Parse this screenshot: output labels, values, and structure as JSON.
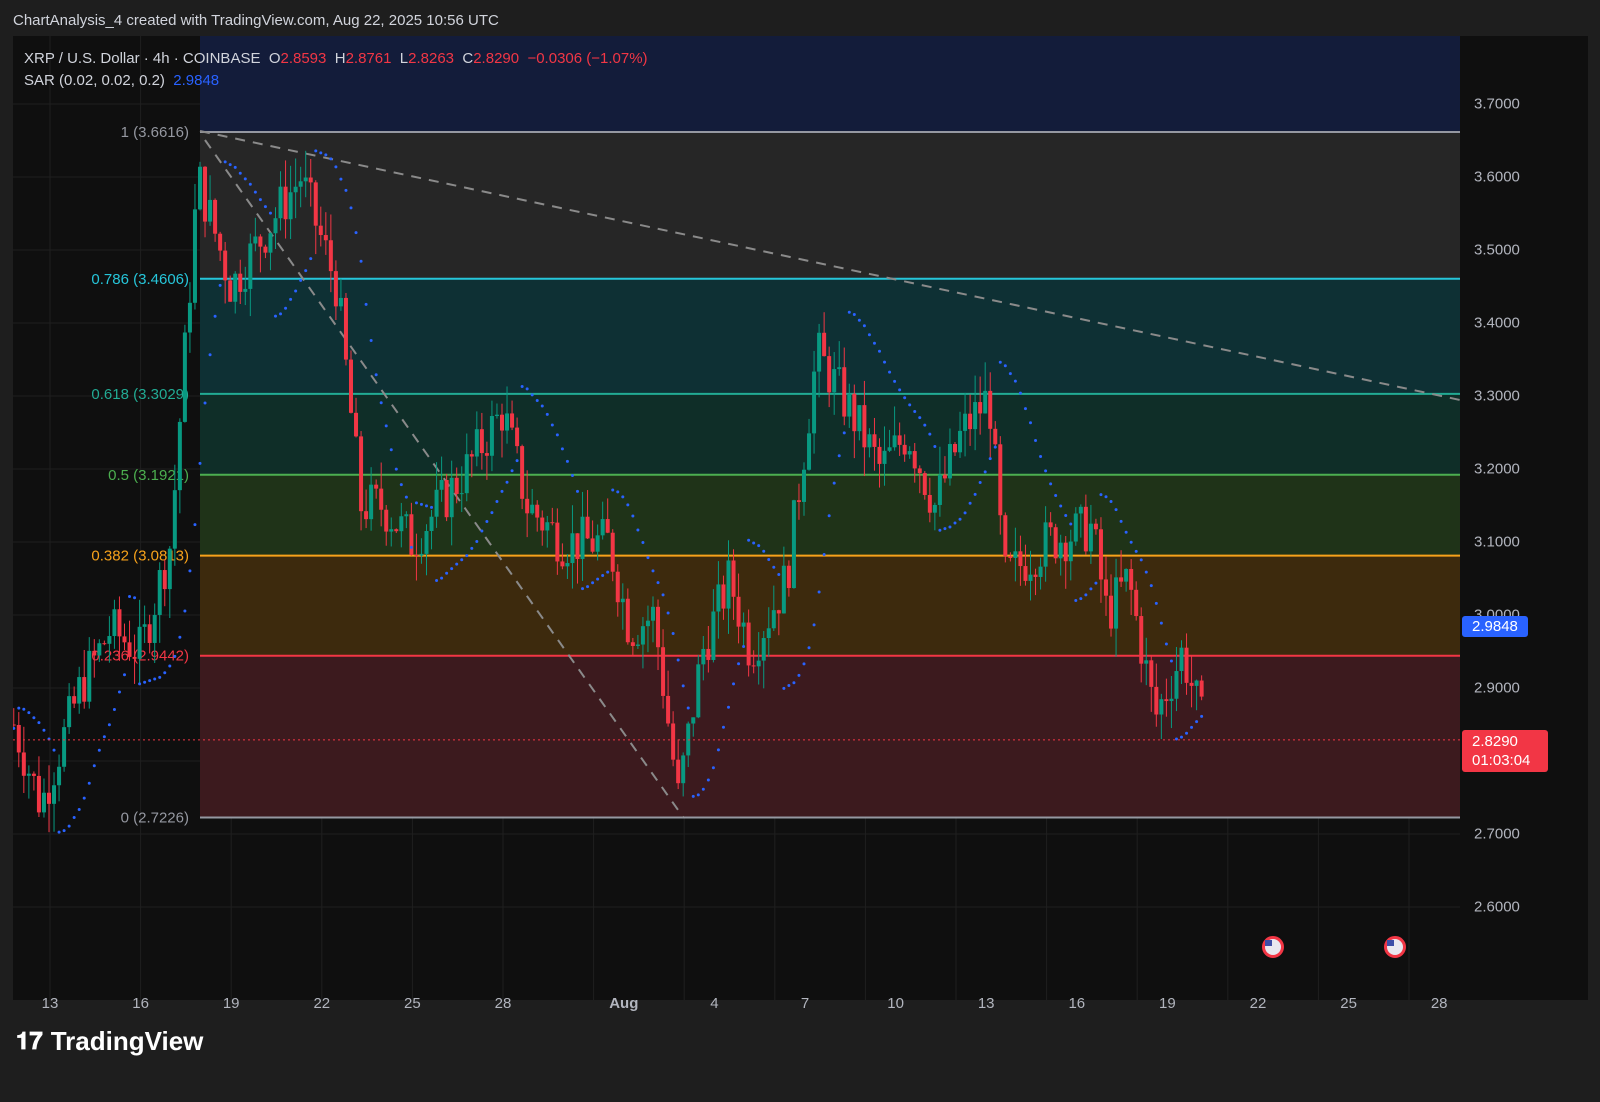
{
  "header": {
    "title": "ChartAnalysis_4 created with TradingView.com, Aug 22, 2025 10:56 UTC"
  },
  "legend": {
    "symbol": "XRP / U.S. Dollar · 4h · COINBASE",
    "o_label": "O",
    "open": "2.8593",
    "h_label": "H",
    "high": "2.8761",
    "l_label": "L",
    "low": "2.8263",
    "c_label": "C",
    "close": "2.8290",
    "change": "−0.0306 (−1.07%)",
    "sar_label": "SAR (0.02, 0.02, 0.2)",
    "sar_value": "2.9848"
  },
  "price_axis": {
    "ticks": [
      "3.7000",
      "3.6000",
      "3.5000",
      "3.4000",
      "3.3000",
      "3.2000",
      "3.1000",
      "3.0000",
      "2.9000",
      "2.7000",
      "2.6000"
    ],
    "sar_tag": "2.9848",
    "price_tag": "2.8290",
    "countdown": "01:03:04"
  },
  "time_axis": {
    "ticks": [
      "13",
      "16",
      "19",
      "22",
      "25",
      "28",
      "Aug",
      "4",
      "7",
      "10",
      "13",
      "16",
      "19",
      "22",
      "25",
      "28"
    ]
  },
  "fib_levels": [
    {
      "label": "1 (3.6616)",
      "price": 3.6616,
      "color": "#9598a1"
    },
    {
      "label": "0.786 (3.4606)",
      "price": 3.4606,
      "color": "#26c6da"
    },
    {
      "label": "0.618 (3.3029)",
      "price": 3.3029,
      "color": "#22ab94"
    },
    {
      "label": "0.5 (3.1921)",
      "price": 3.1921,
      "color": "#4caf50"
    },
    {
      "label": "0.382 (3.0813)",
      "price": 3.0813,
      "color": "#f7a21b"
    },
    {
      "label": "0.236 (2.9442)",
      "price": 2.9442,
      "color": "#f23645"
    },
    {
      "label": "0 (2.7226)",
      "price": 2.7226,
      "color": "#9598a1"
    }
  ],
  "chart_data": {
    "type": "candlestick",
    "swings_day_price": [
      [
        -1.2,
        2.85
      ],
      [
        -0.3,
        2.74
      ],
      [
        1,
        2.9
      ],
      [
        2,
        2.98
      ],
      [
        3,
        2.95
      ],
      [
        4,
        3.1
      ],
      [
        4.9,
        3.6
      ],
      [
        6,
        3.45
      ],
      [
        7.5,
        3.55
      ],
      [
        8.3,
        3.6
      ],
      [
        9.5,
        3.45
      ],
      [
        10.3,
        3.15
      ],
      [
        11,
        3.15
      ],
      [
        12,
        3.1
      ],
      [
        13.8,
        3.2
      ],
      [
        15,
        3.28
      ],
      [
        15.8,
        3.15
      ],
      [
        17,
        3.1
      ],
      [
        18.5,
        3.1
      ],
      [
        19.2,
        2.98
      ],
      [
        20,
        3.0
      ],
      [
        20.8,
        2.75
      ],
      [
        21.6,
        2.95
      ],
      [
        22.5,
        3.05
      ],
      [
        23.2,
        2.95
      ],
      [
        24.4,
        3.05
      ],
      [
        25.4,
        3.36
      ],
      [
        26.5,
        3.28
      ],
      [
        27.5,
        3.2
      ],
      [
        28.4,
        3.25
      ],
      [
        29.3,
        3.15
      ],
      [
        30.2,
        3.25
      ],
      [
        31.1,
        3.3
      ],
      [
        31.6,
        3.05
      ],
      [
        33,
        3.1
      ],
      [
        34.5,
        3.12
      ],
      [
        35,
        3.0
      ],
      [
        35.7,
        3.05
      ],
      [
        36.6,
        2.86
      ],
      [
        37.5,
        2.95
      ],
      [
        38.3,
        2.83
      ]
    ],
    "colors": {
      "up": "#089981",
      "down": "#f23645",
      "sar": "#2962ff"
    }
  },
  "branding": {
    "logo_text": "TradingView"
  }
}
